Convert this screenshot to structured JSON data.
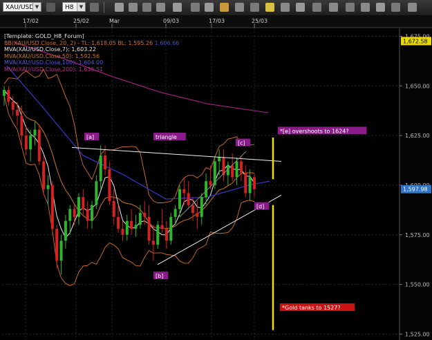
{
  "toolbar": {
    "symbol": "XAU/USD",
    "timeframe": "H8",
    "buttons": [
      "bars-icon",
      "settings-icon",
      "chart-icon",
      "grid-icon",
      "crosshair-icon",
      "hand-icon",
      "pointer-icon",
      "line-icon",
      "text-icon",
      "pencil-icon",
      "zoom-icon",
      "channel-icon",
      "tools-icon",
      "ray-icon",
      "more-icon"
    ]
  },
  "legend": {
    "template": "[Template: GOLD_H8_Forum]",
    "bb": "BB(XAU/USD.Close, 20, 2) - TL: 1,618.05  BL: 1,595.26",
    "bb_tail": "1,606.66",
    "mva7": "MVA(XAU/USD.Close,7): 1,603.22",
    "mva50": "MVA(XAU/USD.Close,50): 1,592.56",
    "mva100": "MVA(XAU/USD.Close,100): 1,604.00",
    "mva200": "MVA(XAU/USD.Close,200): 1,636.51"
  },
  "colors": {
    "background": "#000000",
    "up_candle": "#2db52d",
    "down_candle": "#d42222",
    "bb": "#d8722a",
    "mva7": "#e8e8e8",
    "mva50": "#cc7722",
    "mva100": "#3838d0",
    "mva200": "#a02080",
    "annotation_bg": "#8b1a8b",
    "target_bg": "#e8d70a",
    "warning_bg": "#cc1111",
    "projection_line": "#f0e010"
  },
  "chart_data": {
    "type": "candlestick",
    "instrument": "XAU/USD",
    "timeframe": "H8",
    "x_labels": [
      "17/02",
      "25/02",
      "Mar",
      "09/03",
      "17/03",
      "25/03"
    ],
    "y_ticks": [
      "1,675.00",
      "1,650.00",
      "1,625.00",
      "1,600.00",
      "1,575.00",
      "1,550.00",
      "1,525.00"
    ],
    "ylim": [
      1522,
      1679
    ],
    "price_labels": [
      {
        "name": "high-price-label",
        "text": "1,672.58",
        "price": 1672.58,
        "bg": "#e8d70a"
      },
      {
        "name": "last-price-label",
        "text": "1,597.98",
        "price": 1597.98,
        "bg": "#2f74c6"
      }
    ],
    "candles": [
      [
        1645,
        1650,
        1640,
        1648
      ],
      [
        1648,
        1650,
        1640,
        1642
      ],
      [
        1642,
        1645,
        1635,
        1638
      ],
      [
        1638,
        1642,
        1630,
        1635
      ],
      [
        1635,
        1640,
        1620,
        1625
      ],
      [
        1625,
        1630,
        1615,
        1618
      ],
      [
        1618,
        1628,
        1612,
        1625
      ],
      [
        1625,
        1632,
        1620,
        1628
      ],
      [
        1628,
        1630,
        1610,
        1612
      ],
      [
        1612,
        1615,
        1595,
        1598
      ],
      [
        1598,
        1605,
        1590,
        1600
      ],
      [
        1600,
        1602,
        1575,
        1578
      ],
      [
        1578,
        1580,
        1558,
        1562
      ],
      [
        1562,
        1575,
        1555,
        1572
      ],
      [
        1572,
        1585,
        1568,
        1582
      ],
      [
        1582,
        1590,
        1575,
        1588
      ],
      [
        1588,
        1590,
        1580,
        1584
      ],
      [
        1584,
        1596,
        1580,
        1594
      ],
      [
        1594,
        1598,
        1585,
        1588
      ],
      [
        1588,
        1592,
        1578,
        1582
      ],
      [
        1582,
        1592,
        1578,
        1590
      ],
      [
        1590,
        1605,
        1588,
        1602
      ],
      [
        1602,
        1620,
        1598,
        1615
      ],
      [
        1615,
        1620,
        1605,
        1608
      ],
      [
        1608,
        1612,
        1590,
        1592
      ],
      [
        1592,
        1598,
        1580,
        1584
      ],
      [
        1584,
        1590,
        1576,
        1578
      ],
      [
        1578,
        1582,
        1572,
        1575
      ],
      [
        1575,
        1585,
        1572,
        1582
      ],
      [
        1582,
        1588,
        1575,
        1578
      ],
      [
        1578,
        1585,
        1574,
        1580
      ],
      [
        1580,
        1590,
        1578,
        1586
      ],
      [
        1586,
        1592,
        1580,
        1584
      ],
      [
        1584,
        1590,
        1570,
        1572
      ],
      [
        1572,
        1580,
        1562,
        1570
      ],
      [
        1570,
        1582,
        1568,
        1580
      ],
      [
        1580,
        1588,
        1576,
        1578
      ],
      [
        1578,
        1582,
        1568,
        1572
      ],
      [
        1572,
        1586,
        1570,
        1584
      ],
      [
        1584,
        1590,
        1580,
        1588
      ],
      [
        1588,
        1600,
        1584,
        1598
      ],
      [
        1598,
        1604,
        1590,
        1596
      ],
      [
        1596,
        1602,
        1588,
        1590
      ],
      [
        1590,
        1594,
        1582,
        1586
      ],
      [
        1586,
        1592,
        1578,
        1584
      ],
      [
        1584,
        1596,
        1580,
        1594
      ],
      [
        1594,
        1606,
        1590,
        1602
      ],
      [
        1602,
        1610,
        1598,
        1600
      ],
      [
        1600,
        1614,
        1598,
        1612
      ],
      [
        1612,
        1618,
        1605,
        1614
      ],
      [
        1614,
        1618,
        1602,
        1605
      ],
      [
        1605,
        1612,
        1600,
        1610
      ],
      [
        1610,
        1616,
        1602,
        1604
      ],
      [
        1604,
        1614,
        1600,
        1612
      ],
      [
        1612,
        1615,
        1602,
        1606
      ],
      [
        1606,
        1610,
        1594,
        1596
      ],
      [
        1596,
        1608,
        1592,
        1604
      ],
      [
        1604,
        1606,
        1594,
        1598
      ]
    ],
    "annotations": [
      {
        "name": "wave-a-label",
        "text": "[a]"
      },
      {
        "name": "triangle-label",
        "text": "triangle"
      },
      {
        "name": "wave-c-label",
        "text": "[c]"
      },
      {
        "name": "wave-b-label",
        "text": "[b]"
      },
      {
        "name": "wave-d-label",
        "text": "[d]"
      },
      {
        "name": "overshoot-note",
        "text": "*[e] overshoots to 1624?"
      },
      {
        "name": "gold-tanks-note",
        "text": "*Gold tanks to 1527?"
      }
    ]
  }
}
